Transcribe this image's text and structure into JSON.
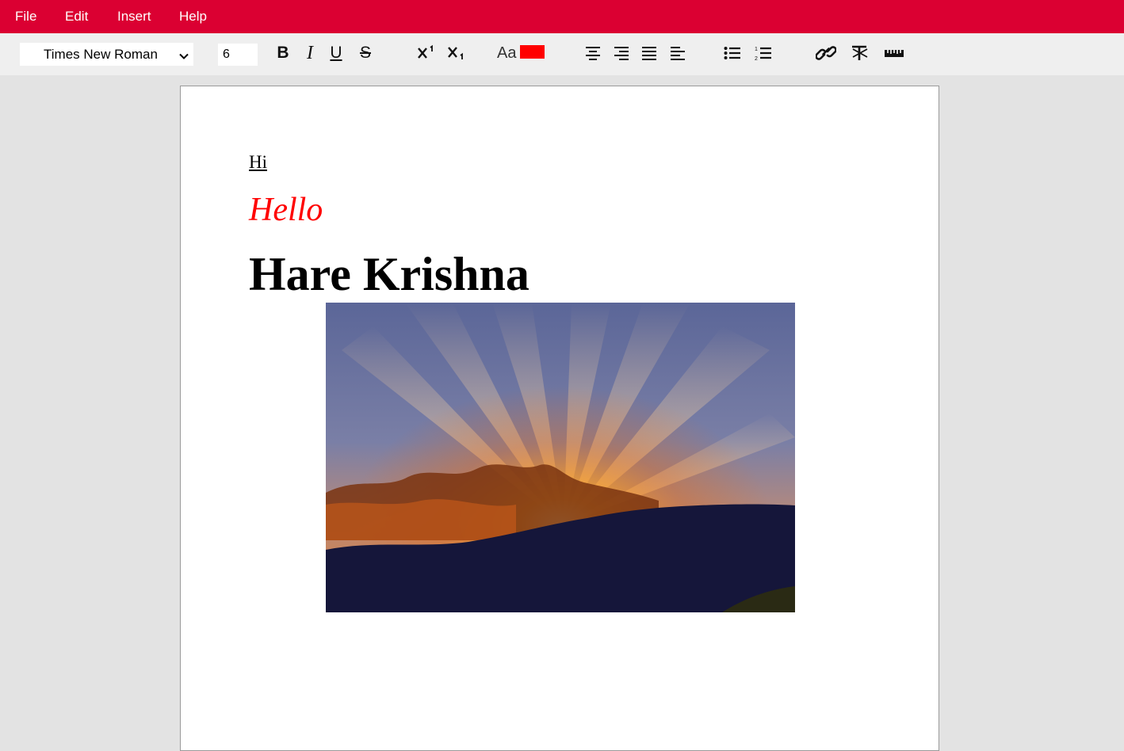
{
  "menu": {
    "items": [
      "File",
      "Edit",
      "Insert",
      "Help"
    ]
  },
  "toolbar": {
    "font_family": "Times New Roman",
    "font_size": "6",
    "text_color_label": "Aa",
    "text_color": "#ff0000",
    "buttons": {
      "bold": "B",
      "italic": "I",
      "underline": "U",
      "strikethrough": "S"
    }
  },
  "document": {
    "lines": [
      {
        "text": "Hi",
        "style": "underline"
      },
      {
        "text": "Hello",
        "style": "italic",
        "color": "#ff0000"
      },
      {
        "text": "Hare Krishna",
        "style": "bold-heading"
      }
    ],
    "image": {
      "subject": "sunset-rays-over-mountains"
    }
  },
  "colors": {
    "menubar": "#db0032",
    "toolbar": "#efefef",
    "workspace": "#e3e3e3"
  }
}
